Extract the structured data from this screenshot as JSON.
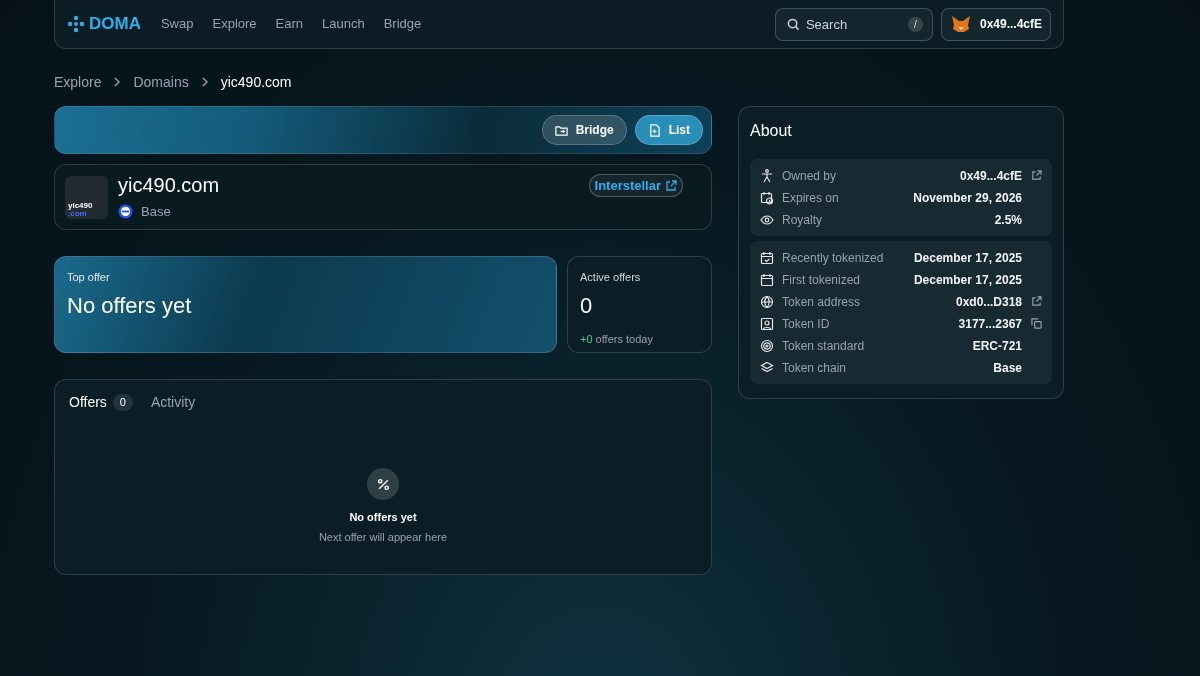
{
  "nav": {
    "logo": "DOMA",
    "links": [
      "Swap",
      "Explore",
      "Earn",
      "Launch",
      "Bridge"
    ],
    "search": {
      "placeholder": "Search",
      "shortcut": "/"
    },
    "wallet": "0x49...4cfE"
  },
  "breadcrumbs": [
    "Explore",
    "Domains",
    "yic490.com"
  ],
  "banner_buttons": [
    "Bridge",
    "List"
  ],
  "domain": {
    "thumbnail": {
      "name": "yic490",
      "tld": ".com"
    },
    "name": "yic490.com",
    "chain": "Base",
    "registrar": "Interstellar"
  },
  "top_offer": {
    "label": "Top offer",
    "value": "No offers yet"
  },
  "active_offers": {
    "label": "Active offers",
    "value": "0",
    "delta": "+0",
    "delta_label": "offers today"
  },
  "offers_panel": {
    "tabs": [
      {
        "label": "Offers",
        "count": "0",
        "selected": true
      },
      {
        "label": "Activity",
        "selected": false
      }
    ],
    "empty_title": "No offers yet",
    "empty_text": "Next offer will appear here"
  },
  "about": {
    "title": "About",
    "groups": [
      [
        {
          "label": "Owned by",
          "value": "0x49...4cfE",
          "external_link": true
        },
        {
          "label": "Expires on",
          "value": "November 29, 2026"
        },
        {
          "label": "Royalty",
          "value": "2.5%"
        }
      ],
      [
        {
          "label": "Recently tokenized",
          "value": "December 17, 2025"
        },
        {
          "label": "First tokenized",
          "value": "December 17, 2025"
        },
        {
          "label": "Token address",
          "value": "0xd0...D318",
          "external_link": true
        },
        {
          "label": "Token ID",
          "value": "3177...2367",
          "copyable": true
        },
        {
          "label": "Token standard",
          "value": "ERC-721"
        },
        {
          "label": "Token chain",
          "value": "Base"
        }
      ]
    ]
  }
}
